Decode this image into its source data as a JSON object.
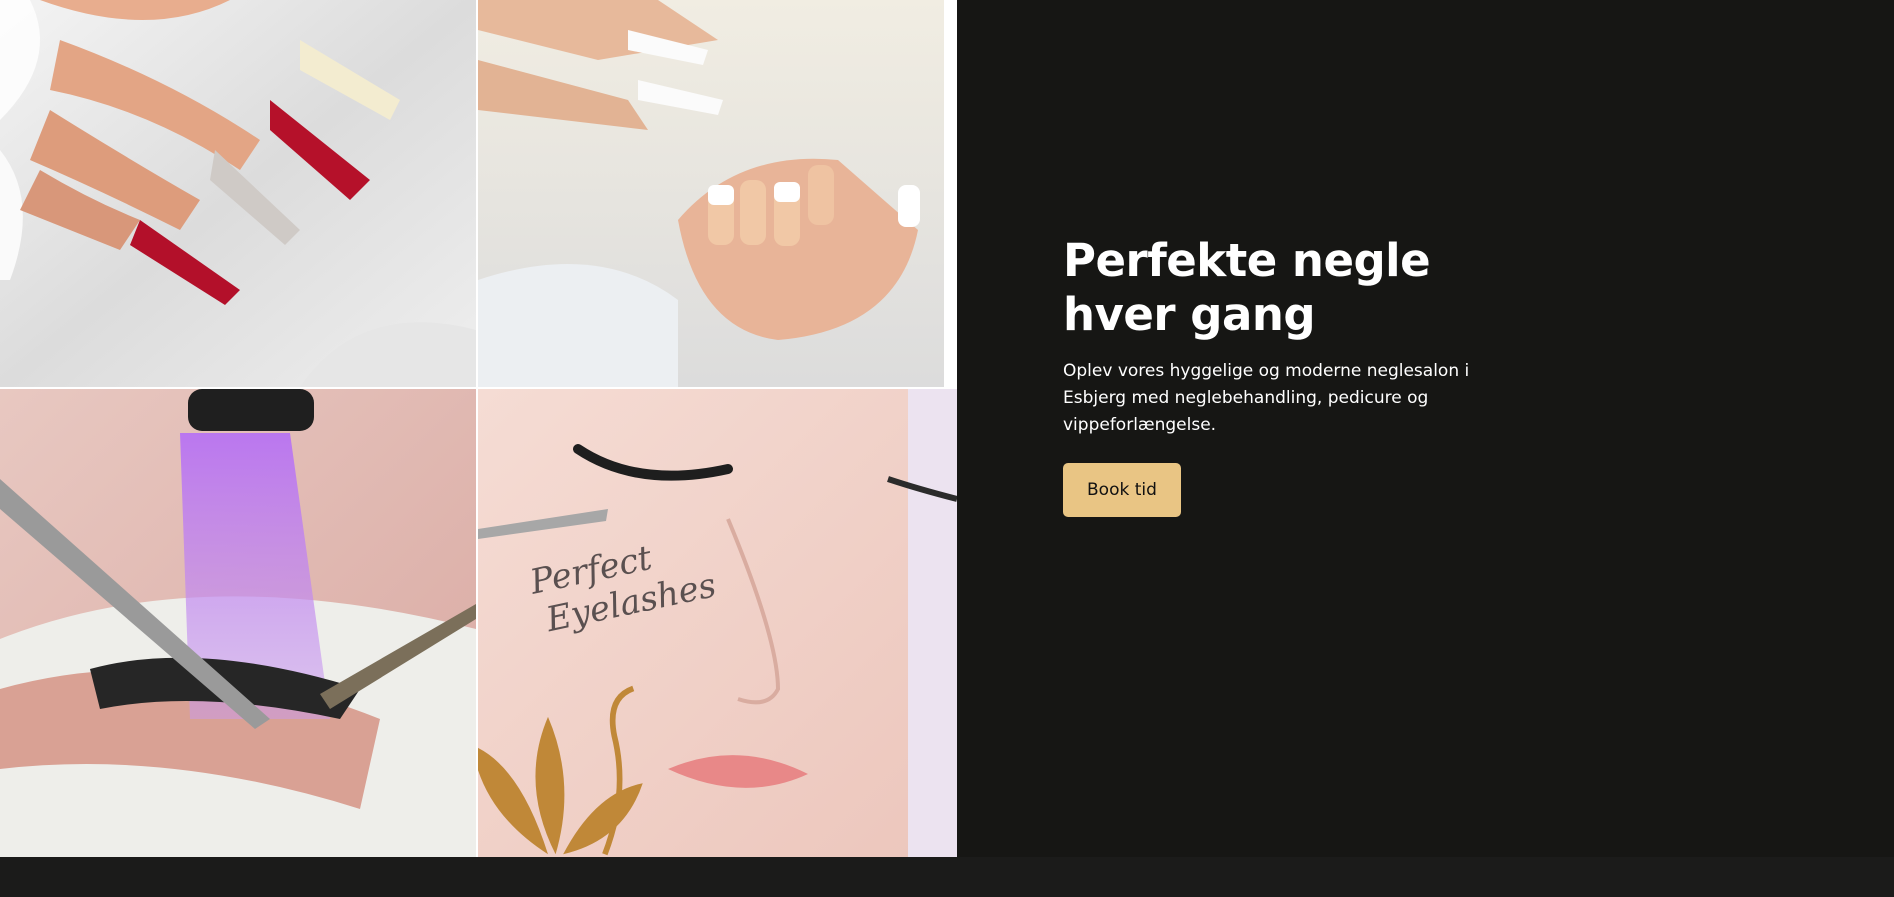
{
  "hero": {
    "headline_line1": "Perfekte negle",
    "headline_line2": "hver gang",
    "description": "Oplev vores hyggelige og moderne neglesalon i Esbjerg med neglebehandling, pedicure og vippeforlængelse.",
    "cta_label": "Book tid"
  },
  "gallery": {
    "eyelash_script_line1": "Perfect",
    "eyelash_script_line2": "Eyelashes"
  },
  "colors": {
    "background": "#161614",
    "accent": "#e9c584",
    "heading_text": "#ffffff",
    "swan_logo": "#c08838"
  }
}
